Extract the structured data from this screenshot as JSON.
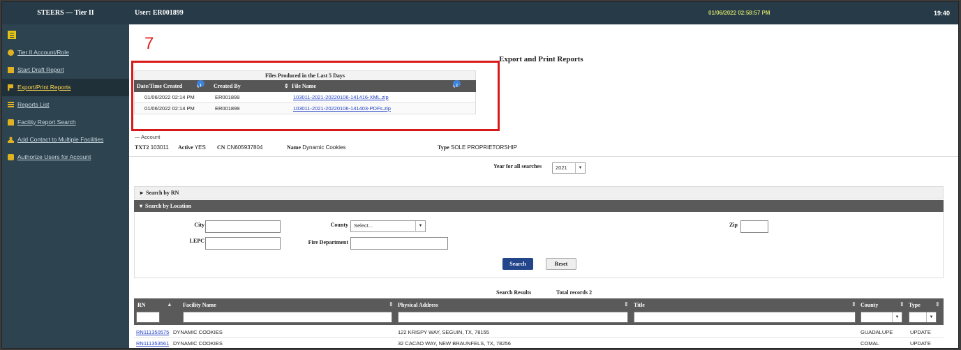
{
  "header": {
    "app_title": "STEERS — Tier II",
    "user": "User: ER001899",
    "datetime": "01/06/2022 02:58:57 PM",
    "clock": "19:40"
  },
  "colors": {
    "header_bg": "#263a47",
    "sidebar_bg": "#2d434f",
    "accent": "#e0b222",
    "highlight": "#d81919"
  },
  "sidebar": {
    "items": [
      {
        "label": "Tier II Account/Role",
        "icon": "gear-icon"
      },
      {
        "label": "Start Draft Report",
        "icon": "report-icon"
      },
      {
        "label": "Export/Print Reports",
        "icon": "export-icon",
        "active": true
      },
      {
        "label": "Reports List",
        "icon": "list-icon"
      },
      {
        "label": "Facility Report Search",
        "icon": "binoculars-icon"
      },
      {
        "label": "Add Contact to Multiple Facilities",
        "icon": "user-icon"
      },
      {
        "label": "Authorize Users for Account",
        "icon": "lock-icon"
      }
    ]
  },
  "annotation": "7",
  "page_title": "Export and Print Reports",
  "files": {
    "caption": "Files Produced in the Last 5 Days",
    "columns": [
      "Date/Time Created",
      "Created By",
      "File Name"
    ],
    "sort_badge_1": "1",
    "sort_badge_2": "2",
    "rows": [
      {
        "date": "01/06/2022 02:14 PM",
        "by": "ER001899",
        "file": "103011-2021-20220106-141416-XML.zip"
      },
      {
        "date": "01/06/2022 02:14 PM",
        "by": "ER001899",
        "file": "103011-2021-20220106-141403-PDFs.zip"
      }
    ]
  },
  "account": {
    "label": "Account",
    "txt2_label": "TXT2",
    "txt2": "103011",
    "active_label": "Active",
    "active": "YES",
    "cn_label": "CN",
    "cn": "CN605937804",
    "name_label": "Name",
    "name": "Dynamic Cookies",
    "type_label": "Type",
    "type": "SOLE PROPRIETORSHIP"
  },
  "year": {
    "label": "Year for all searches",
    "value": "2021"
  },
  "search_rn": "Search by RN",
  "search_location": {
    "title": "Search by Location",
    "city_label": "City",
    "county_label": "County",
    "county_value": "Select...",
    "zip_label": "Zip",
    "lepc_label": "LEPC",
    "fire_label": "Fire Department",
    "search_button": "Search",
    "reset_button": "Reset"
  },
  "results": {
    "caption": "Search Results",
    "total": "Total records 2",
    "columns": [
      "RN",
      "Facility Name",
      "Physical Address",
      "Title",
      "County",
      "Type"
    ],
    "rows": [
      {
        "rn": "RN111350575",
        "name": "DYNAMIC COOKIES",
        "address": "122 KRISPY WAY, SEGUIN, TX, 78155",
        "title": "",
        "county": "GUADALUPE",
        "type": "UPDATE"
      },
      {
        "rn": "RN111353561",
        "name": "DYNAMIC COOKIES",
        "address": "32 CACAO WAY, NEW BRAUNFELS, TX, 78256",
        "title": "",
        "county": "COMAL",
        "type": "UPDATE"
      }
    ]
  }
}
